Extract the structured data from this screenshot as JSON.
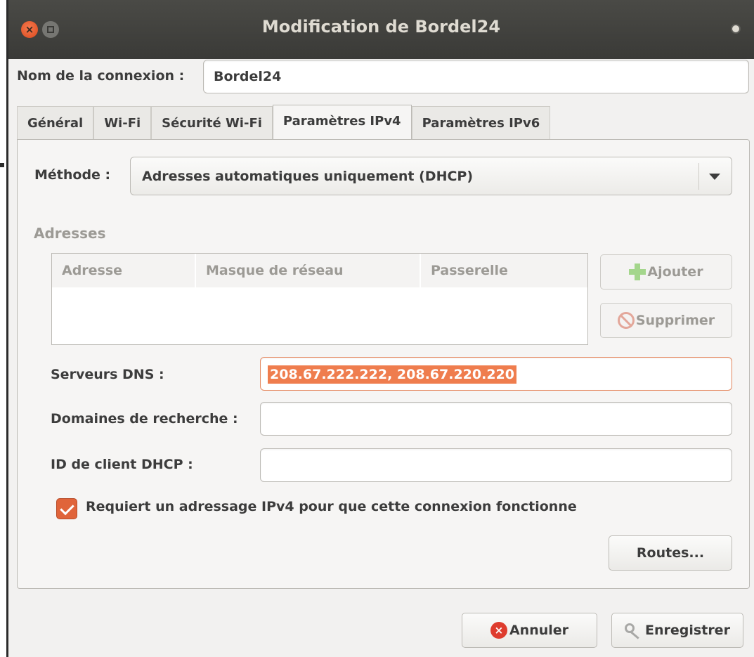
{
  "window": {
    "title": "Modification de Bordel24"
  },
  "connection": {
    "name_label": "Nom de la connexion :",
    "name_value": "Bordel24"
  },
  "tabs": [
    {
      "label": "Général"
    },
    {
      "label": "Wi-Fi"
    },
    {
      "label": "Sécurité Wi-Fi"
    },
    {
      "label": "Paramètres IPv4",
      "active": true
    },
    {
      "label": "Paramètres IPv6"
    }
  ],
  "ipv4": {
    "method_label": "Méthode :",
    "method_value": "Adresses automatiques uniquement (DHCP)",
    "addresses_header": "Adresses",
    "table_columns": [
      "Adresse",
      "Masque de réseau",
      "Passerelle"
    ],
    "add_label": "Ajouter",
    "delete_label": "Supprimer",
    "dns_label": "Serveurs DNS :",
    "dns_value": "208.67.222.222, 208.67.220.220",
    "search_domains_label": "Domaines de recherche :",
    "search_domains_value": "",
    "dhcp_client_id_label": "ID de client DHCP :",
    "dhcp_client_id_value": "",
    "require_ipv4_label": "Requiert un adressage IPv4 pour que cette connexion fonctionne",
    "require_ipv4_checked": true,
    "routes_label": "Routes..."
  },
  "footer": {
    "cancel_label": "Annuler",
    "save_label": "Enregistrer"
  },
  "icons": {
    "close": "close-icon",
    "maximize": "maximize-icon",
    "add": "plus-icon",
    "delete": "forbid-icon",
    "cancel": "cancel-icon",
    "save": "key-icon",
    "dropdown": "chevron-down-icon"
  },
  "colors": {
    "accent": "#e0643a",
    "selection": "#ef7d4e",
    "titlebar": "#3c3b37"
  }
}
